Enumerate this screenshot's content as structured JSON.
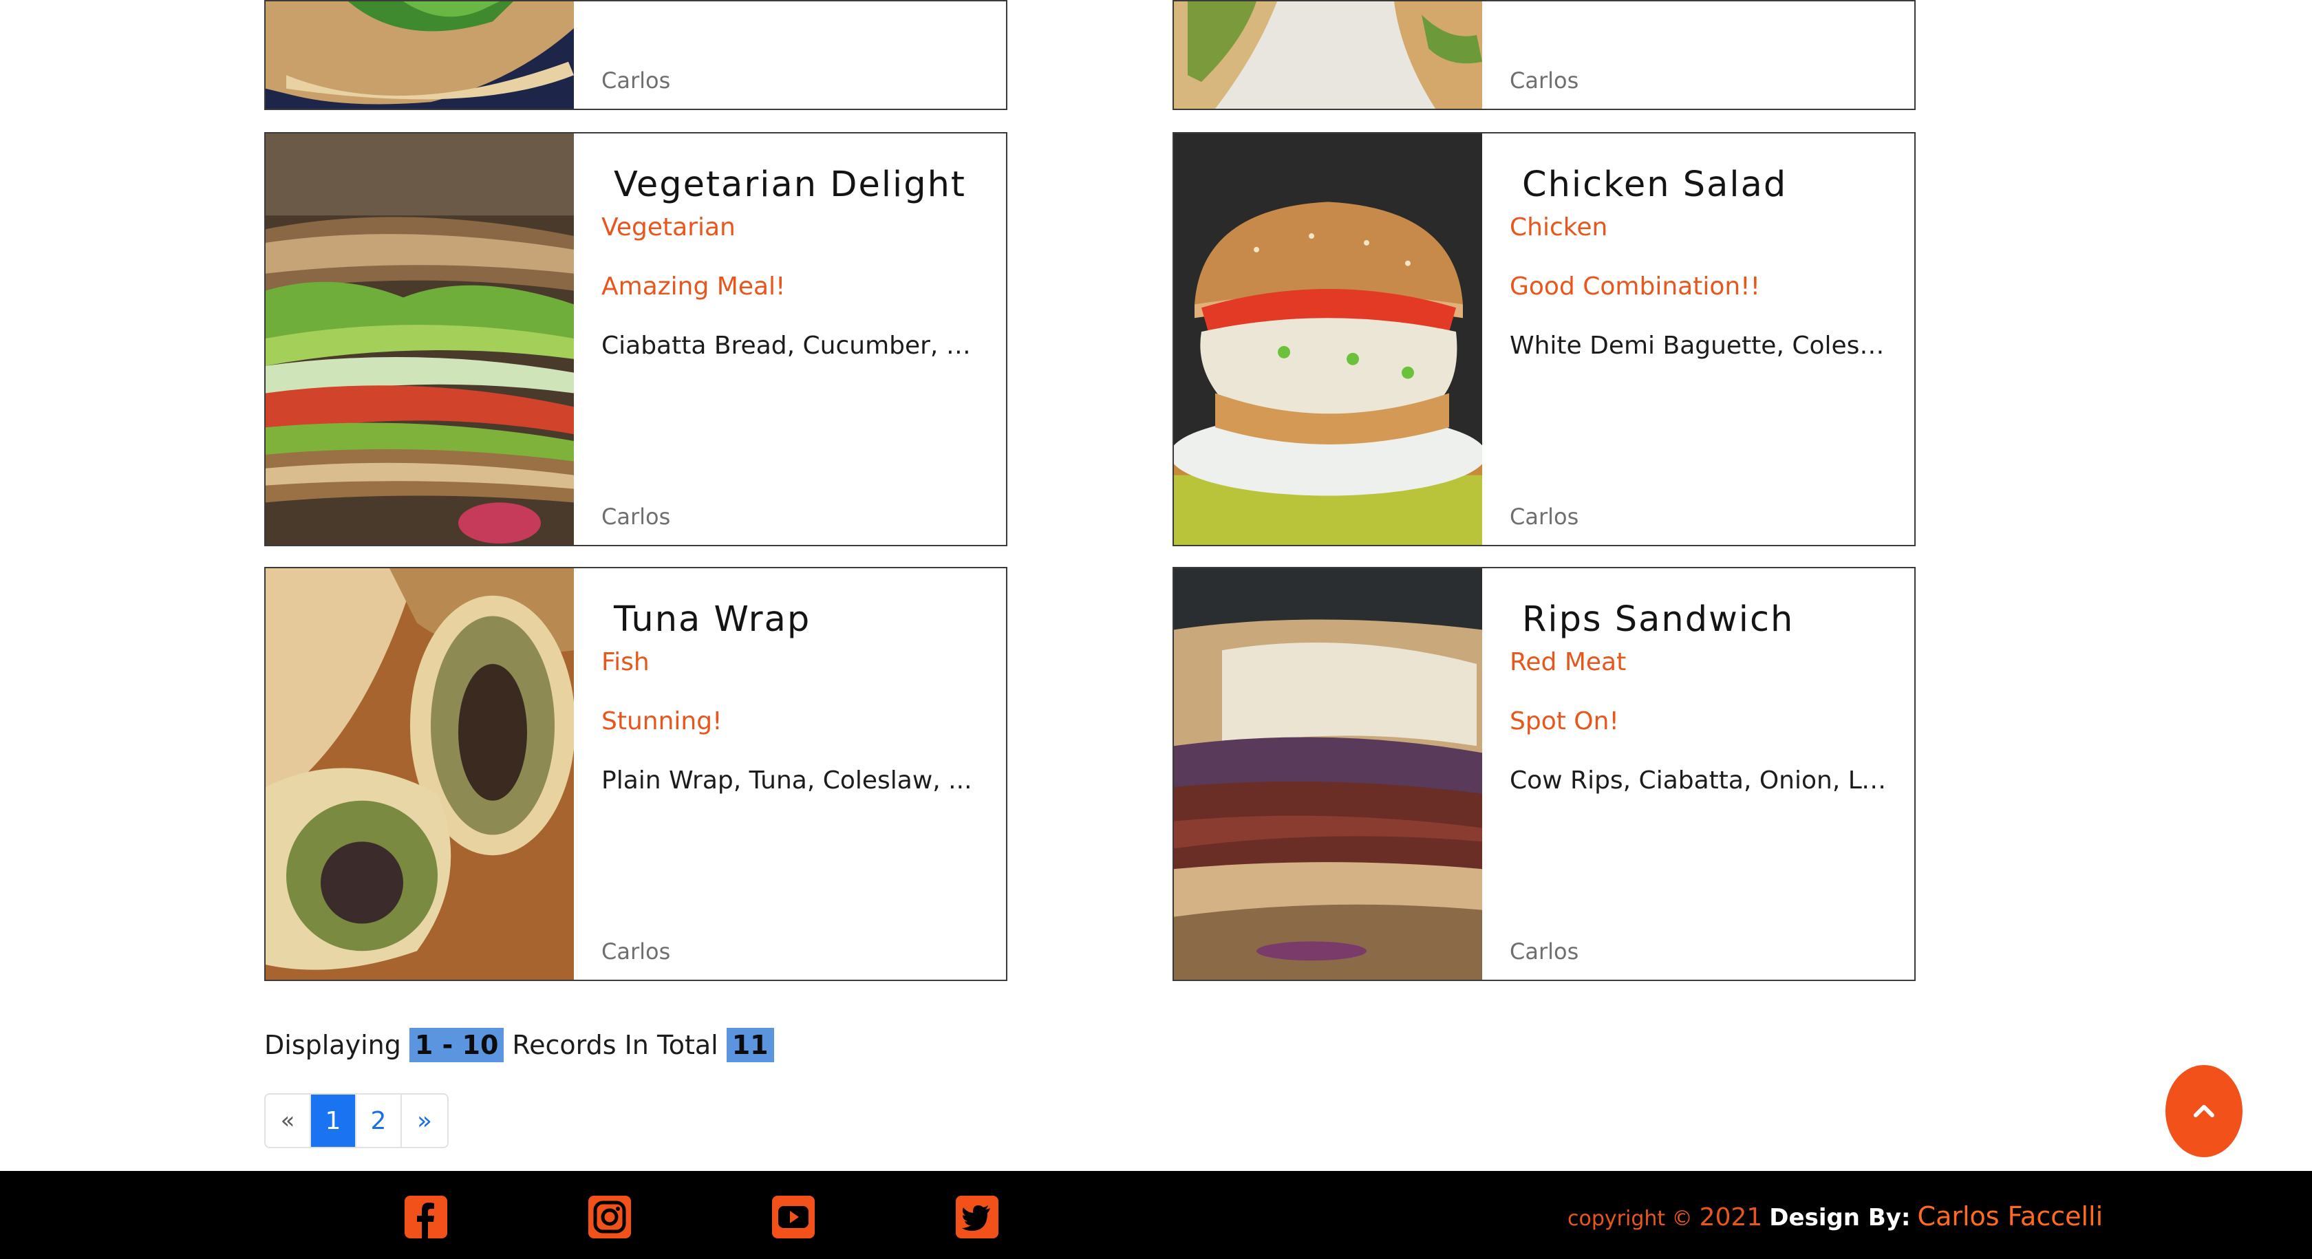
{
  "cards": [
    {
      "title": "",
      "category": "",
      "tagline": "",
      "ingredients": "",
      "author": "Carlos"
    },
    {
      "title": "",
      "category": "",
      "tagline": "",
      "ingredients": "",
      "author": "Carlos"
    },
    {
      "title": "Vegetarian Delight",
      "category": "Vegetarian",
      "tagline": "Amazing Meal!",
      "ingredients": "Ciabatta Bread, Cucumber, T...",
      "author": "Carlos"
    },
    {
      "title": "Chicken Salad",
      "category": "Chicken",
      "tagline": "Good Combination!!",
      "ingredients": "White Demi Baguette, Colesl...",
      "author": "Carlos"
    },
    {
      "title": "Tuna Wrap",
      "category": "Fish",
      "tagline": "Stunning!",
      "ingredients": "Plain Wrap, Tuna, Coleslaw, ...",
      "author": "Carlos"
    },
    {
      "title": "Rips Sandwich",
      "category": "Red Meat",
      "tagline": "Spot On!",
      "ingredients": "Cow Rips, Ciabatta, Onion, Le...",
      "author": "Carlos"
    }
  ],
  "records": {
    "prefix": "Displaying",
    "range": "1 - 10",
    "middle": "Records In Total",
    "total": "11"
  },
  "pagination": {
    "prev": "«",
    "pages": [
      "1",
      "2"
    ],
    "active": "1",
    "next": "»"
  },
  "back_to_top": {
    "icon": "chevron-up-icon"
  },
  "footer": {
    "social": [
      "facebook-icon",
      "instagram-icon",
      "youtube-icon",
      "twitter-icon"
    ],
    "copyright_label": "copyright ©",
    "year": "2021",
    "design_label": "Design By:",
    "designer": "Carlos Faccelli"
  },
  "colors": {
    "accent": "#e8561c",
    "pager_active": "#1a73f0",
    "highlight": "#5b95e0",
    "footer_bg": "#000000"
  }
}
